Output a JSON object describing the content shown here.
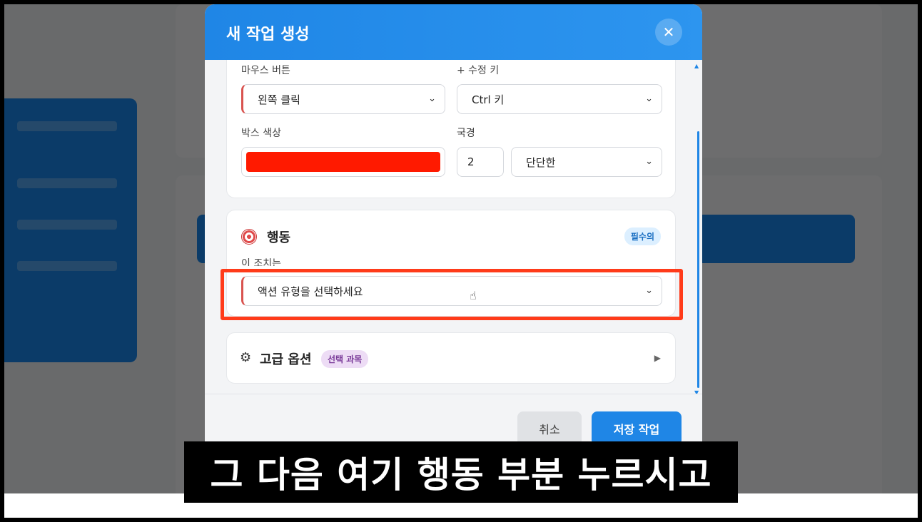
{
  "modal": {
    "title": "새 작업 생성",
    "close_symbol": "✕",
    "fields": {
      "mouse_button_label": "마우스 버튼",
      "mouse_button_value": "왼쪽 클릭",
      "modifier_label": "+ 수정 키",
      "modifier_value": "Ctrl 키",
      "box_color_label": "박스 색상",
      "box_color_value": "#ff1a00",
      "border_label": "국경",
      "border_width_value": "2",
      "border_style_value": "단단한"
    },
    "action_section": {
      "title": "행동",
      "icon": "target-icon",
      "badge": "필수의",
      "field_label": "이 조치는",
      "select_value": "액션 유형을 선택하세요"
    },
    "advanced_section": {
      "title": "고급 옵션",
      "icon": "gear-icon",
      "badge": "선택 과목",
      "expand_symbol": "▶"
    },
    "footer": {
      "cancel_label": "취소",
      "save_label": "저장 작업"
    }
  },
  "subtitle": "그 다음 여기 행동 부분 누르시고",
  "colors": {
    "accent": "#1f86e6",
    "highlight": "#ff3b1a",
    "swatch": "#ff1a00"
  }
}
